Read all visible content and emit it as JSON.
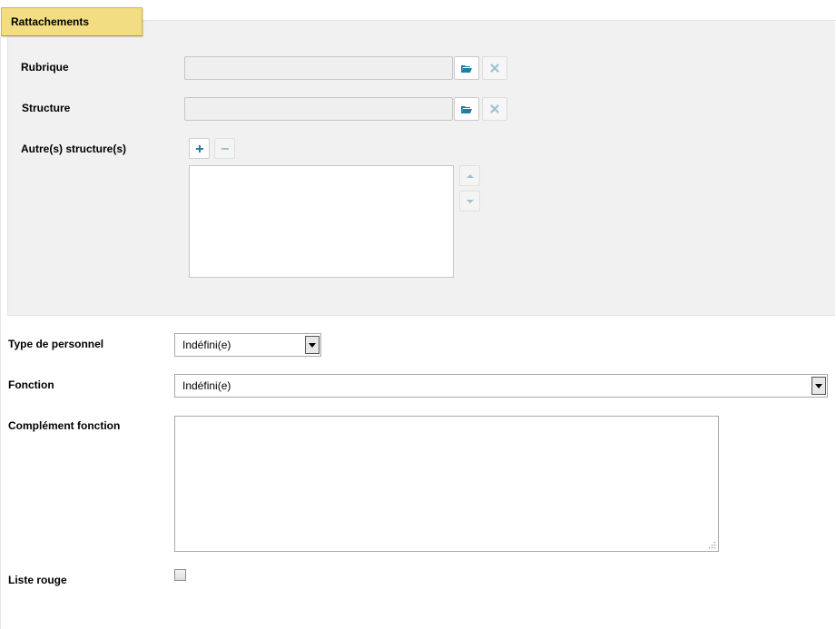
{
  "section": {
    "title": "Rattachements"
  },
  "rattachements": {
    "rubrique": {
      "label": "Rubrique",
      "value": ""
    },
    "structure": {
      "label": "Structure",
      "value": ""
    },
    "autres_structures": {
      "label": "Autre(s) structure(s)",
      "items": []
    }
  },
  "fields": {
    "type_personnel": {
      "label": "Type de personnel",
      "selected": "Indéfini(e)"
    },
    "fonction": {
      "label": "Fonction",
      "selected": "Indéfini(e)"
    },
    "complement_fonction": {
      "label": "Complément fonction",
      "value": ""
    },
    "liste_rouge": {
      "label": "Liste rouge",
      "checked": false
    }
  },
  "icons": {
    "browse": "folder-open-icon",
    "clear": "close-icon",
    "add": "plus-icon",
    "remove": "minus-icon",
    "move_up": "arrow-up-icon",
    "move_down": "arrow-down-icon",
    "dropdown": "dropdown-arrow-icon"
  },
  "colors": {
    "legend_bg": "#f3dd82",
    "panel_bg": "#f1f1f1",
    "icon_accent": "#1f7ea3",
    "icon_disabled": "#9fc0cf"
  }
}
